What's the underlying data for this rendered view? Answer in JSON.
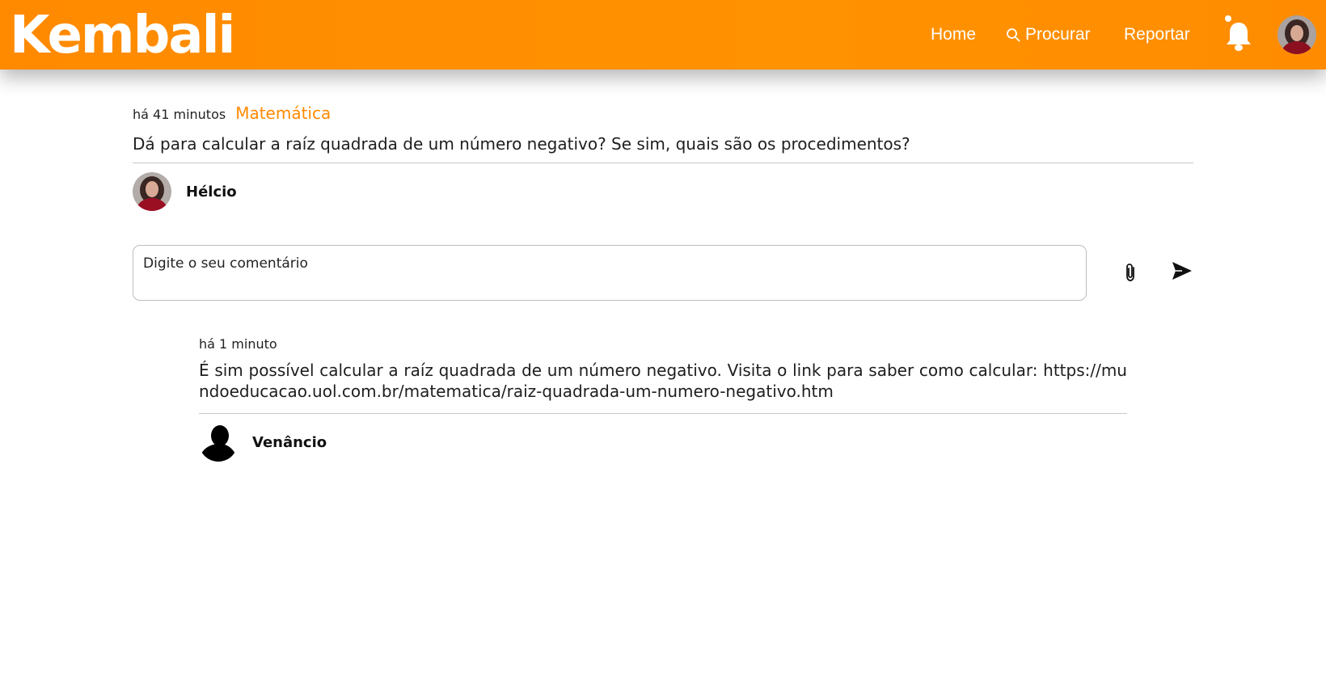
{
  "header": {
    "logo": "Kembali",
    "nav": {
      "home": "Home",
      "search": "Procurar",
      "report": "Reportar"
    },
    "icons": {
      "search": "search-icon",
      "bell": "bell-icon",
      "avatar": "user-avatar"
    },
    "colors": {
      "accent": "#ff8a00"
    }
  },
  "post": {
    "time": "há 41 minutos",
    "subject": "Matemática",
    "question": "Dá para calcular a raíz quadrada de um número negativo? Se sim, quais são os procedimentos?",
    "author": "Hélcio"
  },
  "comment_input": {
    "placeholder": "Digite o seu comentário",
    "attach_icon": "paperclip-icon",
    "send_icon": "send-icon"
  },
  "answers": [
    {
      "time": "há 1 minuto",
      "text": "É sim possível calcular a raíz quadrada de um número negativo. Visita o link para saber como calcular: https://mundoeducacao.uol.com.br/matematica/raiz-quadrada-um-numero-negativo.htm",
      "author": "Venâncio"
    }
  ]
}
